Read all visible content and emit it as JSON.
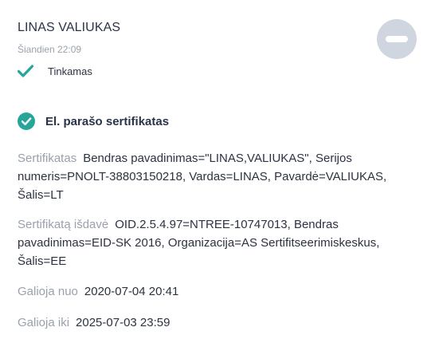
{
  "signer": {
    "name": "LINAS VALIUKAS",
    "time": "Šiandien 22:09",
    "status": "Tinkamas",
    "status_icon": "check-icon",
    "status_color": "#26a69a"
  },
  "remove_button": {
    "icon": "minus-circle-icon",
    "color": "#d0d6df"
  },
  "certificate": {
    "title": "El. parašo sertifikatas",
    "title_icon": "check-circle-icon",
    "fields": {
      "certificate": {
        "label": "Sertifikatas",
        "value": "Bendras pavadinimas=\"LINAS,VALIUKAS\", Serijos numeris=PNOLT-38803150218, Vardas=LINAS, Pavardė=VALIUKAS, Šalis=LT"
      },
      "issuer": {
        "label": "Sertifikatą išdavė",
        "value": "OID.2.5.4.97=NTREE-10747013, Bendras pavadinimas=EID-SK 2016, Organizacija=AS Sertifitseerimiskeskus, Šalis=EE"
      },
      "valid_from": {
        "label": "Galioja nuo",
        "value": "2020-07-04 20:41"
      },
      "valid_to": {
        "label": "Galioja iki",
        "value": "2025-07-03 23:59"
      }
    }
  }
}
